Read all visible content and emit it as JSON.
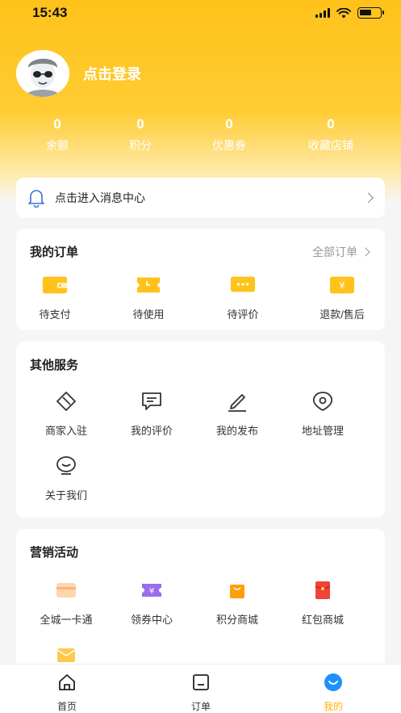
{
  "status_bar": {
    "time": "15:43"
  },
  "profile": {
    "login_label": "点击登录"
  },
  "stats": [
    {
      "value": "0",
      "label": "余额"
    },
    {
      "value": "0",
      "label": "积分"
    },
    {
      "value": "0",
      "label": "优惠券"
    },
    {
      "value": "0",
      "label": "收藏店铺"
    }
  ],
  "message_center": {
    "label": "点击进入消息中心"
  },
  "orders": {
    "title": "我的订单",
    "all_orders": "全部订单",
    "items": [
      {
        "label": "待支付",
        "icon": "wallet-icon"
      },
      {
        "label": "待使用",
        "icon": "ticket-icon"
      },
      {
        "label": "待评价",
        "icon": "comment-dots-icon"
      },
      {
        "label": "退款/售后",
        "icon": "yen-refund-icon"
      }
    ]
  },
  "services": {
    "title": "其他服务",
    "items": [
      {
        "label": "商家入驻",
        "icon": "store-entry-icon"
      },
      {
        "label": "我的评价",
        "icon": "review-icon"
      },
      {
        "label": "我的发布",
        "icon": "edit-pen-icon"
      },
      {
        "label": "地址管理",
        "icon": "location-icon"
      },
      {
        "label": "关于我们",
        "icon": "about-face-icon"
      }
    ]
  },
  "marketing": {
    "title": "营销活动",
    "items": [
      {
        "label": "全城一卡通",
        "icon": "city-card-icon"
      },
      {
        "label": "领券中心",
        "icon": "coupon-center-icon"
      },
      {
        "label": "积分商城",
        "icon": "points-bag-icon"
      },
      {
        "label": "红包商城",
        "icon": "red-packet-icon"
      }
    ]
  },
  "tabbar": [
    {
      "label": "首页",
      "icon": "home-icon"
    },
    {
      "label": "订单",
      "icon": "order-icon"
    },
    {
      "label": "我的",
      "icon": "mine-icon",
      "active": true
    }
  ],
  "colors": {
    "accent": "#ffc21a",
    "active_tab": "#ffb300"
  }
}
